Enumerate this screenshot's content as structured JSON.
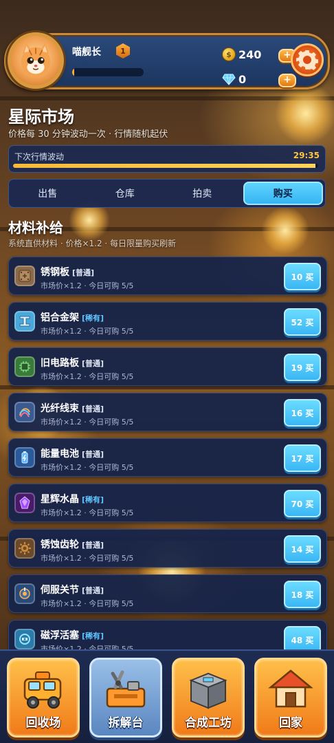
{
  "header": {
    "player_name": "喵舰长",
    "level": "1",
    "exp_progress": 0.03,
    "coins": "240",
    "gems": "0",
    "plus_label": "+",
    "avatar_icon": "cat-astronaut",
    "settings_icon": "gear-icon"
  },
  "page": {
    "title": "星际市场",
    "subtitle": "价格每 30 分钟波动一次 · 行情随机起伏"
  },
  "timer": {
    "label": "下次行情波动",
    "value": "29:35",
    "progress": 0.99
  },
  "tabs": [
    {
      "label": "出售",
      "active": false
    },
    {
      "label": "仓库",
      "active": false
    },
    {
      "label": "拍卖",
      "active": false
    },
    {
      "label": "购买",
      "active": true
    }
  ],
  "section": {
    "title": "材料补给",
    "subtitle": "系统直供材料 · 价格×1.2 · 每日限量购买刷新"
  },
  "items": [
    {
      "name": "锈钢板",
      "rarity": "[普通]",
      "rarity_type": "common",
      "meta": "市场价×1.2 · 今日可购 5/5",
      "price": "10 买",
      "icon": "steel-plate-icon",
      "icon_color": "#8a6a4a"
    },
    {
      "name": "铝合金架",
      "rarity": "[稀有]",
      "rarity_type": "rare",
      "meta": "市场价×1.2 · 今日可购 5/5",
      "price": "52 买",
      "icon": "aluminum-frame-icon",
      "icon_color": "#4aa8d8"
    },
    {
      "name": "旧电路板",
      "rarity": "[普通]",
      "rarity_type": "common",
      "meta": "市场价×1.2 · 今日可购 5/5",
      "price": "19 买",
      "icon": "circuit-board-icon",
      "icon_color": "#3a7a3a"
    },
    {
      "name": "光纤线束",
      "rarity": "[普通]",
      "rarity_type": "common",
      "meta": "市场价×1.2 · 今日可购 5/5",
      "price": "16 买",
      "icon": "fiber-cable-icon",
      "icon_color": "#3a5a90"
    },
    {
      "name": "能量电池",
      "rarity": "[普通]",
      "rarity_type": "common",
      "meta": "市场价×1.2 · 今日可购 5/5",
      "price": "17 买",
      "icon": "energy-battery-icon",
      "icon_color": "#2a5a9a"
    },
    {
      "name": "星辉水晶",
      "rarity": "[稀有]",
      "rarity_type": "rare",
      "meta": "市场价×1.2 · 今日可购 5/5",
      "price": "70 买",
      "icon": "star-crystal-icon",
      "icon_color": "#6a2a9a"
    },
    {
      "name": "锈蚀齿轮",
      "rarity": "[普通]",
      "rarity_type": "common",
      "meta": "市场价×1.2 · 今日可购 5/5",
      "price": "14 买",
      "icon": "rusty-gear-icon",
      "icon_color": "#8a5a2a"
    },
    {
      "name": "伺服关节",
      "rarity": "[普通]",
      "rarity_type": "common",
      "meta": "市场价×1.2 · 今日可购 5/5",
      "price": "18 买",
      "icon": "servo-joint-icon",
      "icon_color": "#2a4a7a"
    },
    {
      "name": "磁浮活塞",
      "rarity": "[稀有]",
      "rarity_type": "rare",
      "meta": "市场价×1.2 · 今日可购 5/5",
      "price": "48 买",
      "icon": "maglev-piston-icon",
      "icon_color": "#2a7aaa"
    }
  ],
  "bottom_nav": [
    {
      "label": "回收场",
      "icon": "truck-icon",
      "style": "orange"
    },
    {
      "label": "拆解台",
      "icon": "dismantle-icon",
      "style": "blue"
    },
    {
      "label": "合成工坊",
      "icon": "crafting-box-icon",
      "style": "orange"
    },
    {
      "label": "回家",
      "icon": "house-icon",
      "style": "orange"
    }
  ]
}
